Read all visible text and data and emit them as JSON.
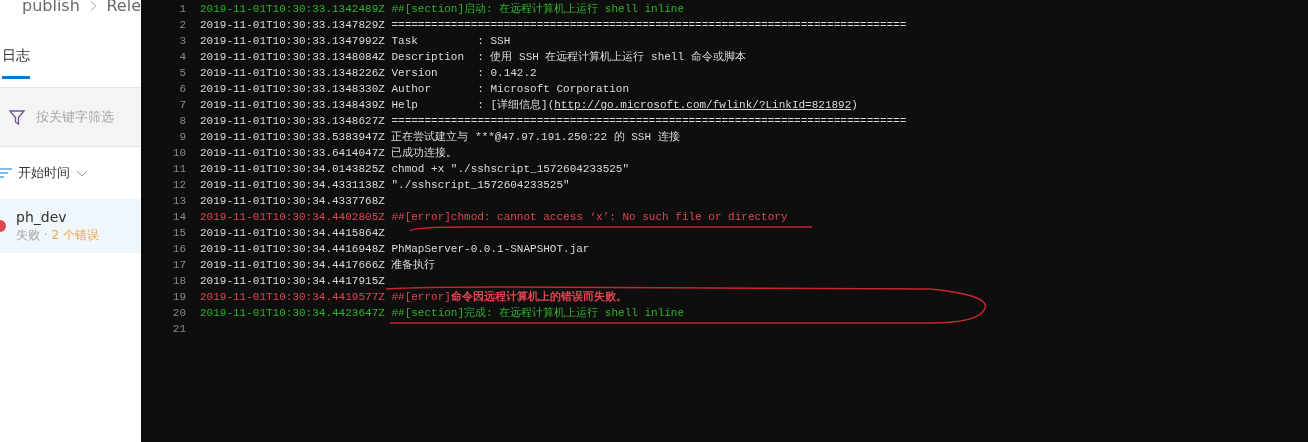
{
  "breadcrumb": [
    "publish",
    "Rele"
  ],
  "tabs": [
    {
      "label": "日志",
      "selected": true
    }
  ],
  "filter": {
    "placeholder": "按关键字筛选"
  },
  "sort": {
    "label": "开始时间"
  },
  "jobs": [
    {
      "name": "ph_dev",
      "status": "失败 ·",
      "errors": "2 个错误",
      "selected": true,
      "color": "#e0454f"
    }
  ],
  "log": [
    {
      "number": "1",
      "kind": "section",
      "time": "2019-11-01T10:30:33.1342489Z",
      "text": "##[section]启动: 在远程计算机上运行 shell inline"
    },
    {
      "number": "2",
      "kind": "normal",
      "time": "2019-11-01T10:30:33.1347829Z",
      "text": "=============================================================================="
    },
    {
      "number": "3",
      "kind": "normal",
      "time": "2019-11-01T10:30:33.1347992Z",
      "text": "Task         : SSH"
    },
    {
      "number": "4",
      "kind": "normal",
      "time": "2019-11-01T10:30:33.1348084Z",
      "text": "Description  : 使用 SSH 在远程计算机上运行 shell 命令或脚本"
    },
    {
      "number": "5",
      "kind": "normal",
      "time": "2019-11-01T10:30:33.1348226Z",
      "text": "Version      : 0.142.2"
    },
    {
      "number": "6",
      "kind": "normal",
      "time": "2019-11-01T10:30:33.1348330Z",
      "text": "Author       : Microsoft Corporation"
    },
    {
      "number": "7",
      "kind": "normal",
      "time": "2019-11-01T10:30:33.1348439Z",
      "text": "Help         : [详细信息](",
      "link": "http://go.microsoft.com/fwlink/?LinkId=821892",
      "suffix": ")"
    },
    {
      "number": "8",
      "kind": "normal",
      "time": "2019-11-01T10:30:33.1348627Z",
      "text": "=============================================================================="
    },
    {
      "number": "9",
      "kind": "normal",
      "time": "2019-11-01T10:30:33.5383947Z",
      "text": "正在尝试建立与 ***@47.97.191.250:22 的 SSH 连接"
    },
    {
      "number": "10",
      "kind": "normal",
      "time": "2019-11-01T10:30:33.6414047Z",
      "text": "已成功连接。"
    },
    {
      "number": "11",
      "kind": "normal",
      "time": "2019-11-01T10:30:34.0143825Z",
      "text": "chmod +x \"./sshscript_1572604233525\""
    },
    {
      "number": "12",
      "kind": "normal",
      "time": "2019-11-01T10:30:34.4331138Z",
      "text": "\"./sshscript_1572604233525\""
    },
    {
      "number": "13",
      "kind": "normal",
      "time": "2019-11-01T10:30:34.4337768Z"
    },
    {
      "number": "14",
      "kind": "error",
      "time": "2019-11-01T10:30:34.4402805Z",
      "text": "##[error]chmod: cannot access ‘x’: No such file or directory"
    },
    {
      "number": "15",
      "kind": "normal",
      "time": "2019-11-01T10:30:34.4415864Z"
    },
    {
      "number": "16",
      "kind": "normal",
      "time": "2019-11-01T10:30:34.4416948Z",
      "text": "PhMapServer-0.0.1-SNAPSHOT.jar"
    },
    {
      "number": "17",
      "kind": "normal",
      "time": "2019-11-01T10:30:34.4417666Z",
      "text": "准备执行"
    },
    {
      "number": "18",
      "kind": "normal",
      "time": "2019-11-01T10:30:34.4417915Z"
    },
    {
      "number": "19",
      "kind": "error",
      "time": "2019-11-01T10:30:34.4419577Z",
      "text": "##[error]**命令因远程计算机上的错误而失败。**"
    },
    {
      "number": "20",
      "kind": "section",
      "time": "2019-11-01T10:30:34.4423647Z",
      "text": "##[section]完成: 在远程计算机上运行 shell inline"
    },
    {
      "number": "21",
      "kind": "empty"
    }
  ]
}
